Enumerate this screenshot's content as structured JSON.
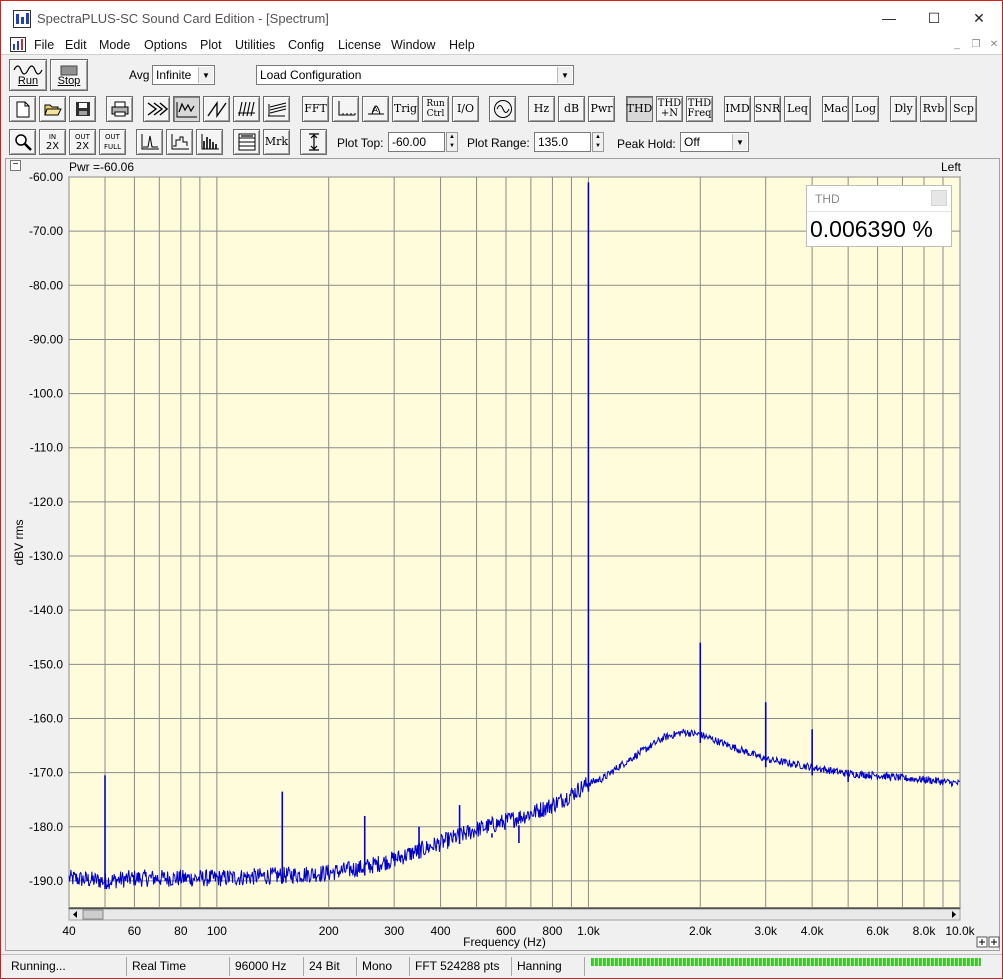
{
  "window": {
    "title": "SpectraPLUS-SC Sound Card Edition - [Spectrum]",
    "minimize": "—",
    "maximize": "☐",
    "close": "✕"
  },
  "menu": [
    "File",
    "Edit",
    "Mode",
    "Options",
    "Plot",
    "Utilities",
    "Config",
    "License",
    "Window",
    "Help"
  ],
  "toolbar1": {
    "run_label": "Run",
    "stop_label": "Stop",
    "avg_label": "Avg",
    "avg_value": "Infinite",
    "config_value": "Load Configuration"
  },
  "toolbar2": {
    "fft": "FFT",
    "trig": "Trig",
    "run_ctrl_1": "Run",
    "run_ctrl_2": "Ctrl",
    "io": "I/O",
    "hz": "Hz",
    "db": "dB",
    "pwr": "Pwr",
    "thd": "THD",
    "thdn_1": "THD",
    "thdn_2": "+N",
    "thdf_1": "THD",
    "thdf_2": "Freq",
    "imd": "IMD",
    "snr": "SNR",
    "leq": "Leq",
    "mac": "Mac",
    "log": "Log",
    "dly": "Dly",
    "rvb": "Rvb",
    "scp": "Scp"
  },
  "toolbar3": {
    "in_label": "IN",
    "in_2x": "2X",
    "out_label": "OUT",
    "out_2x": "2X",
    "out_full_label": "OUT",
    "out_full": "FULL",
    "mrk": "Mrk",
    "plot_top_label": "Plot Top:",
    "plot_top_value": "-60.00",
    "plot_range_label": "Plot Range:",
    "plot_range_value": "135.0",
    "peak_hold_label": "Peak Hold:",
    "peak_hold_value": "Off"
  },
  "plot": {
    "collapse": "−",
    "cursor_readout": "Pwr =-60.06",
    "channel": "Left",
    "ylabel": "dBV rms",
    "xlabel": "Frequency (Hz)"
  },
  "thd_meter": {
    "title": "THD",
    "value": "0.006390 %"
  },
  "status": {
    "state": "Running...",
    "mode": "Real Time",
    "rate": "96000 Hz",
    "bits": "24 Bit",
    "channels": "Mono",
    "fft": "FFT 524288 pts",
    "window": "Hanning"
  },
  "colors": {
    "plot_bg": "#fffcdc",
    "trace": "#0000c8",
    "grid": "#8a8a8a"
  },
  "chart_data": {
    "type": "line",
    "title": "",
    "xlabel": "Frequency (Hz)",
    "ylabel": "dBV rms",
    "x_scale": "log",
    "xlim": [
      40,
      10000
    ],
    "ylim": [
      -195,
      -60
    ],
    "grid": true,
    "y_ticks": [
      -60,
      -70,
      -80,
      -90,
      -100,
      -110,
      -120,
      -130,
      -140,
      -150,
      -160,
      -170,
      -180,
      -190
    ],
    "y_tick_labels": [
      "-60.00",
      "-70.00",
      "-80.00",
      "-90.00",
      "-100.0",
      "-110.0",
      "-120.0",
      "-130.0",
      "-140.0",
      "-150.0",
      "-160.0",
      "-170.0",
      "-180.0",
      "-190.0"
    ],
    "x_ticks": [
      40,
      60,
      80,
      100,
      200,
      300,
      400,
      600,
      800,
      1000,
      2000,
      3000,
      4000,
      6000,
      8000,
      10000
    ],
    "x_tick_labels": [
      "40",
      "60",
      "80",
      "100",
      "200",
      "300",
      "400",
      "600",
      "800",
      "1.0k",
      "2.0k",
      "3.0k",
      "4.0k",
      "6.0k",
      "8.0k",
      "10.0k"
    ],
    "noise_floor": [
      [
        40,
        -189.5
      ],
      [
        50,
        -190
      ],
      [
        60,
        -189.5
      ],
      [
        80,
        -189.5
      ],
      [
        100,
        -189.5
      ],
      [
        150,
        -189
      ],
      [
        200,
        -188.5
      ],
      [
        250,
        -187.5
      ],
      [
        300,
        -186
      ],
      [
        400,
        -183
      ],
      [
        500,
        -180.5
      ],
      [
        600,
        -179
      ],
      [
        700,
        -177.5
      ],
      [
        800,
        -176
      ],
      [
        900,
        -174
      ],
      [
        1000,
        -172
      ],
      [
        1100,
        -171
      ],
      [
        1200,
        -169
      ],
      [
        1400,
        -166
      ],
      [
        1600,
        -163.5
      ],
      [
        1800,
        -162.5
      ],
      [
        2000,
        -163
      ],
      [
        2500,
        -165.5
      ],
      [
        3000,
        -167.5
      ],
      [
        4000,
        -169
      ],
      [
        5000,
        -170.2
      ],
      [
        6000,
        -170.5
      ],
      [
        7000,
        -171
      ],
      [
        8000,
        -171.3
      ],
      [
        10000,
        -172
      ]
    ],
    "peaks": [
      [
        50,
        -170.5
      ],
      [
        150,
        -173.5
      ],
      [
        250,
        -178
      ],
      [
        350,
        -180
      ],
      [
        450,
        -176
      ],
      [
        550,
        -182
      ],
      [
        650,
        -183
      ],
      [
        1000,
        -61
      ],
      [
        2000,
        -146
      ],
      [
        3000,
        -157
      ],
      [
        4000,
        -162
      ],
      [
        5000,
        -169.5
      ]
    ]
  }
}
